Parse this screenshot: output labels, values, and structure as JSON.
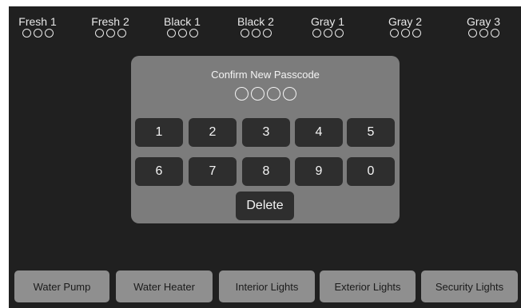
{
  "tanks": [
    {
      "label": "Fresh 1",
      "dots": 3
    },
    {
      "label": "Fresh 2",
      "dots": 3
    },
    {
      "label": "Black 1",
      "dots": 3
    },
    {
      "label": "Black 2",
      "dots": 3
    },
    {
      "label": "Gray 1",
      "dots": 3
    },
    {
      "label": "Gray 2",
      "dots": 3
    },
    {
      "label": "Gray 3",
      "dots": 3
    }
  ],
  "dialog": {
    "title": "Confirm New Passcode",
    "code_length": 4,
    "keys": [
      "1",
      "2",
      "3",
      "4",
      "5",
      "6",
      "7",
      "8",
      "9",
      "0"
    ],
    "delete_label": "Delete"
  },
  "controls": [
    "Water Pump",
    "Water Heater",
    "Interior Lights",
    "Exterior Lights",
    "Security Lights"
  ],
  "colors": {
    "screen_bg": "#202020",
    "dialog_bg": "#7c7c7c",
    "key_bg": "#2e2e2e",
    "control_bg": "#8f8f8f"
  }
}
